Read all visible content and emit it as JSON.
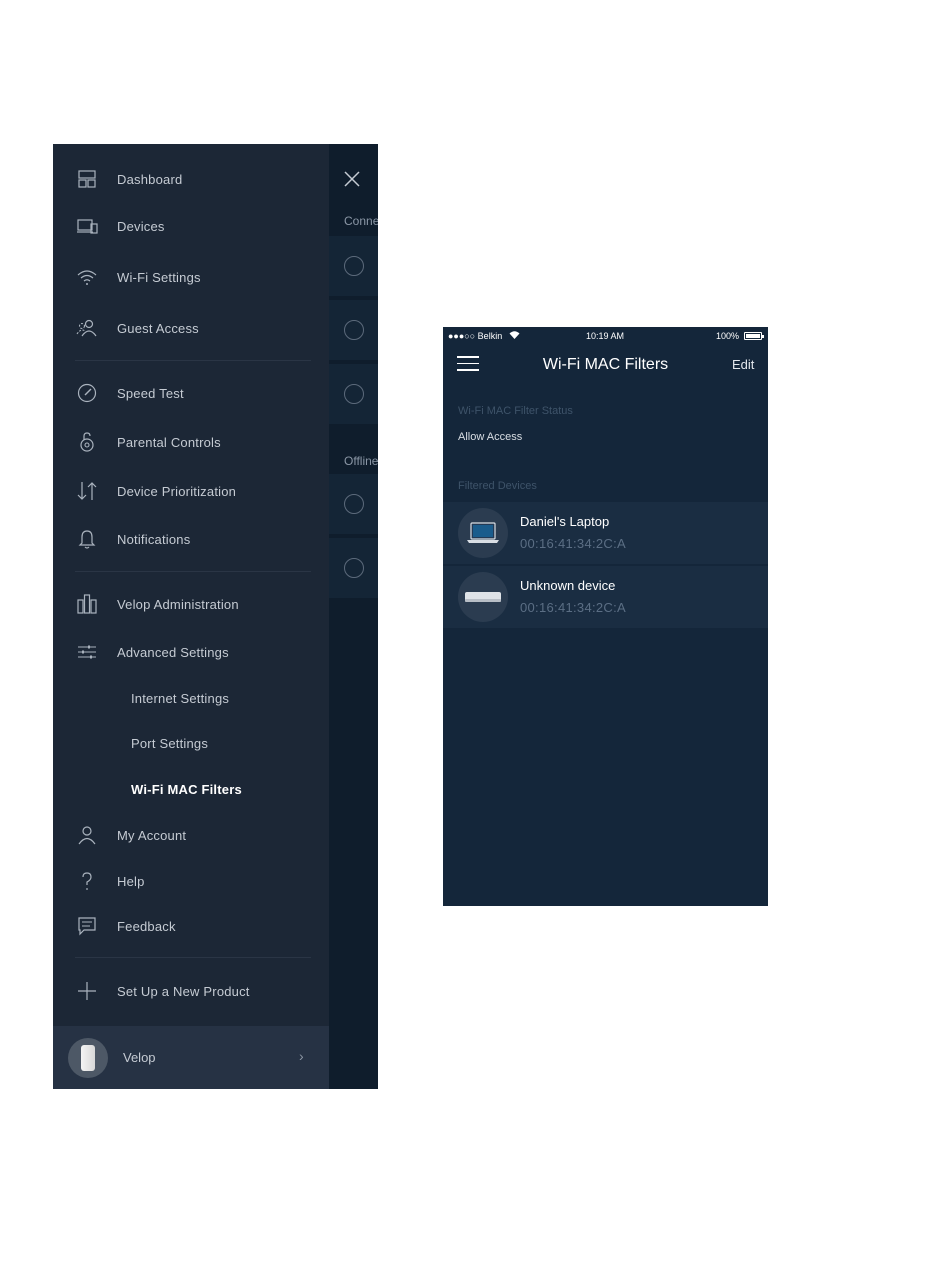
{
  "menu": {
    "items": [
      {
        "id": "dashboard",
        "label": "Dashboard",
        "icon": "dashboard-icon"
      },
      {
        "id": "devices",
        "label": "Devices",
        "icon": "devices-icon"
      },
      {
        "id": "wifi-settings",
        "label": "Wi-Fi Settings",
        "icon": "wifi-icon"
      },
      {
        "id": "guest-access",
        "label": "Guest Access",
        "icon": "guest-icon"
      },
      {
        "id": "speed-test",
        "label": "Speed Test",
        "icon": "speedometer-icon"
      },
      {
        "id": "parental-controls",
        "label": "Parental Controls",
        "icon": "padlock-icon"
      },
      {
        "id": "device-prioritization",
        "label": "Device Prioritization",
        "icon": "arrows-updown-icon"
      },
      {
        "id": "notifications",
        "label": "Notifications",
        "icon": "bell-icon"
      },
      {
        "id": "velop-administration",
        "label": "Velop Administration",
        "icon": "velop-nodes-icon"
      },
      {
        "id": "advanced-settings",
        "label": "Advanced Settings",
        "icon": "sliders-icon"
      },
      {
        "id": "internet-settings",
        "label": "Internet Settings",
        "icon": ""
      },
      {
        "id": "port-settings",
        "label": "Port Settings",
        "icon": ""
      },
      {
        "id": "wifi-mac-filters",
        "label": "Wi-Fi MAC Filters",
        "icon": ""
      },
      {
        "id": "my-account",
        "label": "My Account",
        "icon": "user-icon"
      },
      {
        "id": "help",
        "label": "Help",
        "icon": "question-icon"
      },
      {
        "id": "feedback",
        "label": "Feedback",
        "icon": "chat-icon"
      },
      {
        "id": "set-up-new-product",
        "label": "Set Up a New Product",
        "icon": "plus-icon"
      }
    ],
    "active": "Wi-Fi MAC Filters",
    "footer": {
      "label": "Velop",
      "chevron": "›"
    }
  },
  "background_screen": {
    "section_connected": "Conne",
    "section_offline": "Offline"
  },
  "mac_screen": {
    "status_bar": {
      "carrier": "●●●○○ Belkin",
      "time": "10:19 AM",
      "battery": "100%"
    },
    "title": "Wi-Fi MAC Filters",
    "edit_label": "Edit",
    "status_heading": "Wi-Fi MAC Filter Status",
    "status_value": "Allow Access",
    "devices_heading": "Filtered Devices",
    "devices": [
      {
        "name": "Daniel's Laptop",
        "mac": "00:16:41:34:2C:A",
        "icon": "laptop-icon"
      },
      {
        "name": "Unknown device",
        "mac": "00:16:41:34:2C:A",
        "icon": "generic-device-icon"
      }
    ]
  },
  "colors": {
    "drawer_bg": "#1c2736",
    "screen_bg": "#14263a",
    "row_bg": "#1a2d42",
    "muted_text": "#5b6e84"
  }
}
